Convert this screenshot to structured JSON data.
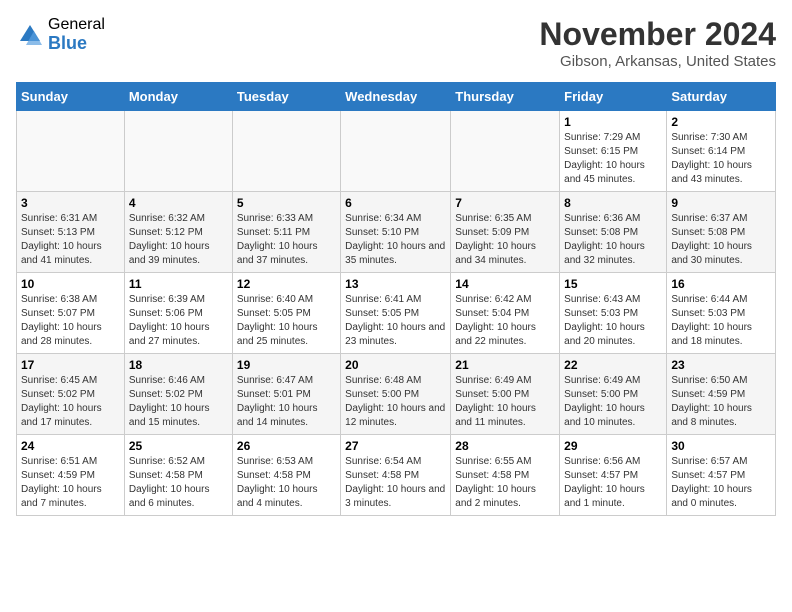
{
  "header": {
    "logo_general": "General",
    "logo_blue": "Blue",
    "month_title": "November 2024",
    "location": "Gibson, Arkansas, United States"
  },
  "weekdays": [
    "Sunday",
    "Monday",
    "Tuesday",
    "Wednesday",
    "Thursday",
    "Friday",
    "Saturday"
  ],
  "weeks": [
    [
      {
        "day": "",
        "info": ""
      },
      {
        "day": "",
        "info": ""
      },
      {
        "day": "",
        "info": ""
      },
      {
        "day": "",
        "info": ""
      },
      {
        "day": "",
        "info": ""
      },
      {
        "day": "1",
        "info": "Sunrise: 7:29 AM\nSunset: 6:15 PM\nDaylight: 10 hours and 45 minutes."
      },
      {
        "day": "2",
        "info": "Sunrise: 7:30 AM\nSunset: 6:14 PM\nDaylight: 10 hours and 43 minutes."
      }
    ],
    [
      {
        "day": "3",
        "info": "Sunrise: 6:31 AM\nSunset: 5:13 PM\nDaylight: 10 hours and 41 minutes."
      },
      {
        "day": "4",
        "info": "Sunrise: 6:32 AM\nSunset: 5:12 PM\nDaylight: 10 hours and 39 minutes."
      },
      {
        "day": "5",
        "info": "Sunrise: 6:33 AM\nSunset: 5:11 PM\nDaylight: 10 hours and 37 minutes."
      },
      {
        "day": "6",
        "info": "Sunrise: 6:34 AM\nSunset: 5:10 PM\nDaylight: 10 hours and 35 minutes."
      },
      {
        "day": "7",
        "info": "Sunrise: 6:35 AM\nSunset: 5:09 PM\nDaylight: 10 hours and 34 minutes."
      },
      {
        "day": "8",
        "info": "Sunrise: 6:36 AM\nSunset: 5:08 PM\nDaylight: 10 hours and 32 minutes."
      },
      {
        "day": "9",
        "info": "Sunrise: 6:37 AM\nSunset: 5:08 PM\nDaylight: 10 hours and 30 minutes."
      }
    ],
    [
      {
        "day": "10",
        "info": "Sunrise: 6:38 AM\nSunset: 5:07 PM\nDaylight: 10 hours and 28 minutes."
      },
      {
        "day": "11",
        "info": "Sunrise: 6:39 AM\nSunset: 5:06 PM\nDaylight: 10 hours and 27 minutes."
      },
      {
        "day": "12",
        "info": "Sunrise: 6:40 AM\nSunset: 5:05 PM\nDaylight: 10 hours and 25 minutes."
      },
      {
        "day": "13",
        "info": "Sunrise: 6:41 AM\nSunset: 5:05 PM\nDaylight: 10 hours and 23 minutes."
      },
      {
        "day": "14",
        "info": "Sunrise: 6:42 AM\nSunset: 5:04 PM\nDaylight: 10 hours and 22 minutes."
      },
      {
        "day": "15",
        "info": "Sunrise: 6:43 AM\nSunset: 5:03 PM\nDaylight: 10 hours and 20 minutes."
      },
      {
        "day": "16",
        "info": "Sunrise: 6:44 AM\nSunset: 5:03 PM\nDaylight: 10 hours and 18 minutes."
      }
    ],
    [
      {
        "day": "17",
        "info": "Sunrise: 6:45 AM\nSunset: 5:02 PM\nDaylight: 10 hours and 17 minutes."
      },
      {
        "day": "18",
        "info": "Sunrise: 6:46 AM\nSunset: 5:02 PM\nDaylight: 10 hours and 15 minutes."
      },
      {
        "day": "19",
        "info": "Sunrise: 6:47 AM\nSunset: 5:01 PM\nDaylight: 10 hours and 14 minutes."
      },
      {
        "day": "20",
        "info": "Sunrise: 6:48 AM\nSunset: 5:00 PM\nDaylight: 10 hours and 12 minutes."
      },
      {
        "day": "21",
        "info": "Sunrise: 6:49 AM\nSunset: 5:00 PM\nDaylight: 10 hours and 11 minutes."
      },
      {
        "day": "22",
        "info": "Sunrise: 6:49 AM\nSunset: 5:00 PM\nDaylight: 10 hours and 10 minutes."
      },
      {
        "day": "23",
        "info": "Sunrise: 6:50 AM\nSunset: 4:59 PM\nDaylight: 10 hours and 8 minutes."
      }
    ],
    [
      {
        "day": "24",
        "info": "Sunrise: 6:51 AM\nSunset: 4:59 PM\nDaylight: 10 hours and 7 minutes."
      },
      {
        "day": "25",
        "info": "Sunrise: 6:52 AM\nSunset: 4:58 PM\nDaylight: 10 hours and 6 minutes."
      },
      {
        "day": "26",
        "info": "Sunrise: 6:53 AM\nSunset: 4:58 PM\nDaylight: 10 hours and 4 minutes."
      },
      {
        "day": "27",
        "info": "Sunrise: 6:54 AM\nSunset: 4:58 PM\nDaylight: 10 hours and 3 minutes."
      },
      {
        "day": "28",
        "info": "Sunrise: 6:55 AM\nSunset: 4:58 PM\nDaylight: 10 hours and 2 minutes."
      },
      {
        "day": "29",
        "info": "Sunrise: 6:56 AM\nSunset: 4:57 PM\nDaylight: 10 hours and 1 minute."
      },
      {
        "day": "30",
        "info": "Sunrise: 6:57 AM\nSunset: 4:57 PM\nDaylight: 10 hours and 0 minutes."
      }
    ]
  ]
}
